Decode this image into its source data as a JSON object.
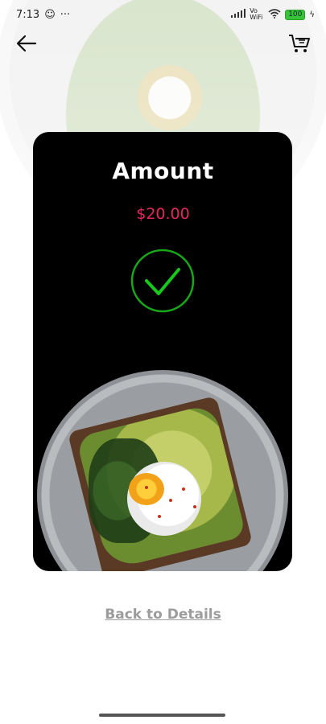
{
  "status_bar": {
    "time": "7:13",
    "network": "Vo WiFi",
    "battery": "100"
  },
  "nav": {
    "back_icon": "arrow-left-icon",
    "cart_icon": "cart-icon"
  },
  "card": {
    "title": "Amount",
    "amount": "$20.00",
    "status_icon": "check-circle-icon",
    "accent_color": "#e8265e",
    "success_color": "#18a81a"
  },
  "footer": {
    "back_link": "Back to Details"
  }
}
